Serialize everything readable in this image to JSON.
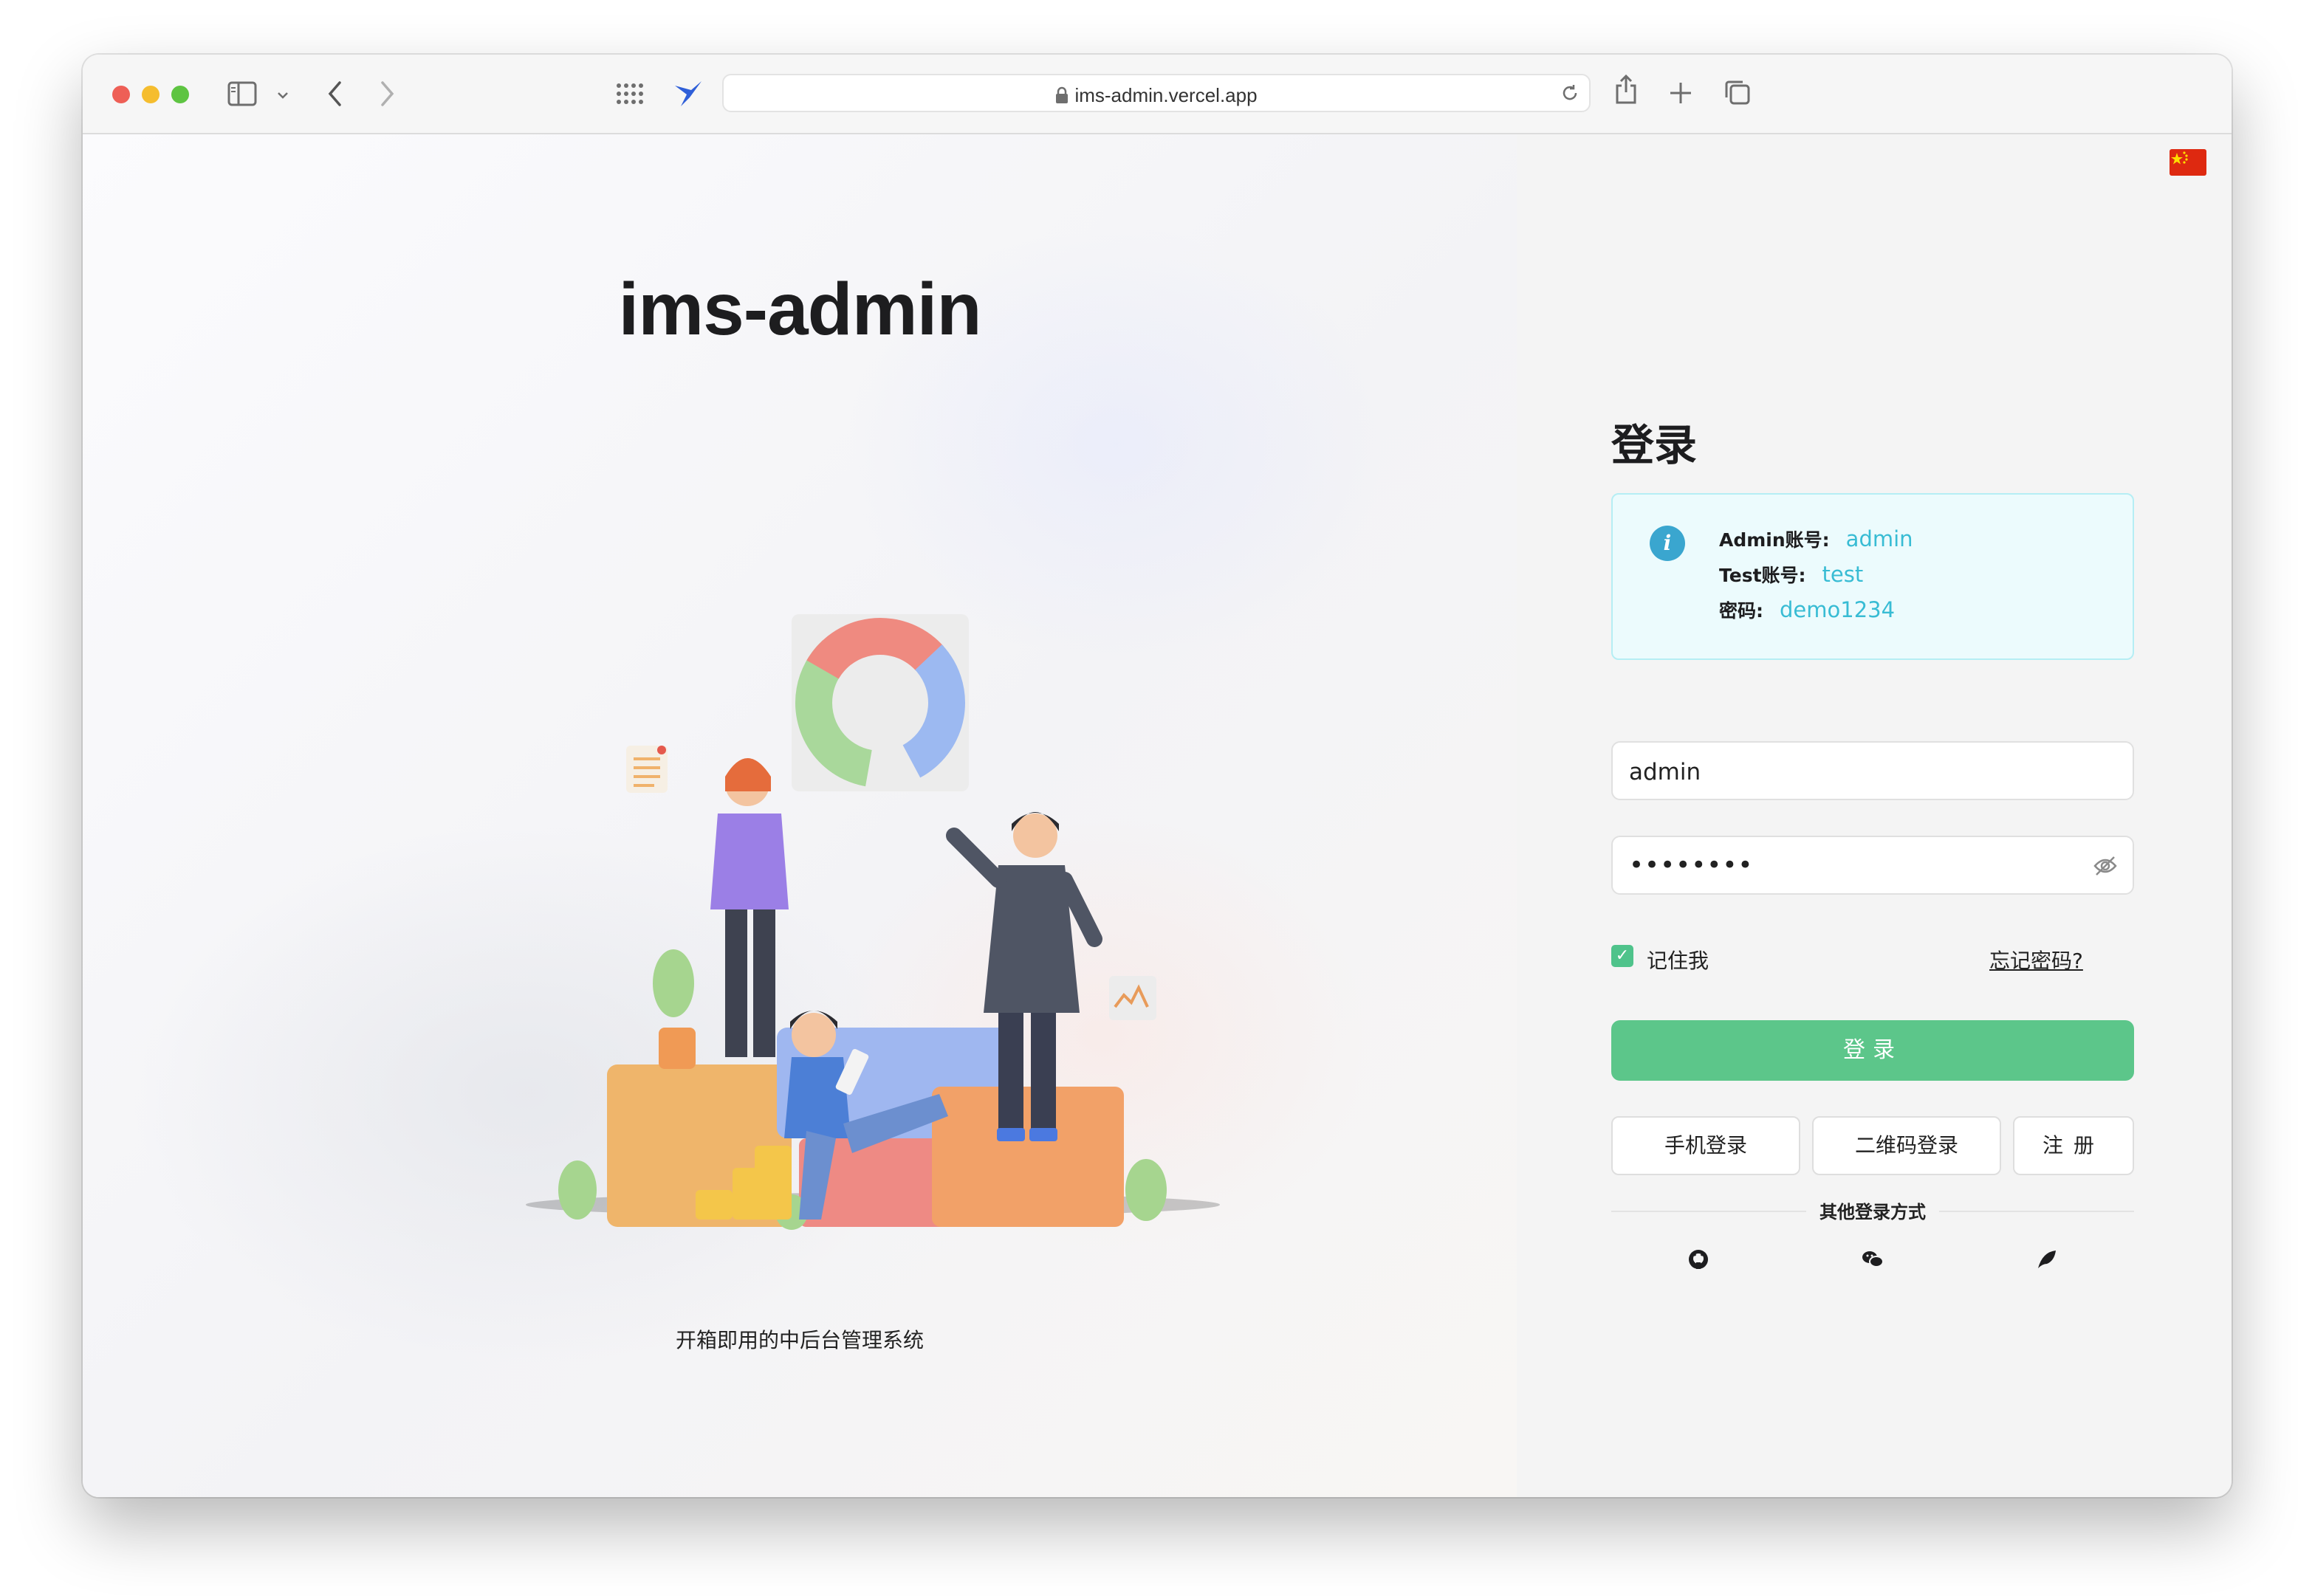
{
  "browser": {
    "url": "ims-admin.vercel.app"
  },
  "left": {
    "app_title": "ims-admin",
    "slogan": "开箱即用的中后台管理系统"
  },
  "login": {
    "title": "登录",
    "info": [
      {
        "key": "Admin账号:",
        "value": "admin"
      },
      {
        "key": "Test账号:",
        "value": "test"
      },
      {
        "key": "密码:",
        "value": "demo1234"
      }
    ],
    "username_value": "admin",
    "password_mask": "••••••••",
    "remember_label": "记住我",
    "remember_checked": true,
    "forgot_label": "忘记密码?",
    "submit_label": "登录",
    "mobile_login_label": "手机登录",
    "qrcode_login_label": "二维码登录",
    "register_label": "注册",
    "other_methods_label": "其他登录方式",
    "social": [
      "github-icon",
      "wechat-icon",
      "bird-icon"
    ]
  },
  "colors": {
    "primary": "#5cc68a",
    "info_accent": "#38bcd4",
    "flag_red": "#de2910",
    "flag_yellow": "#ffde00"
  }
}
